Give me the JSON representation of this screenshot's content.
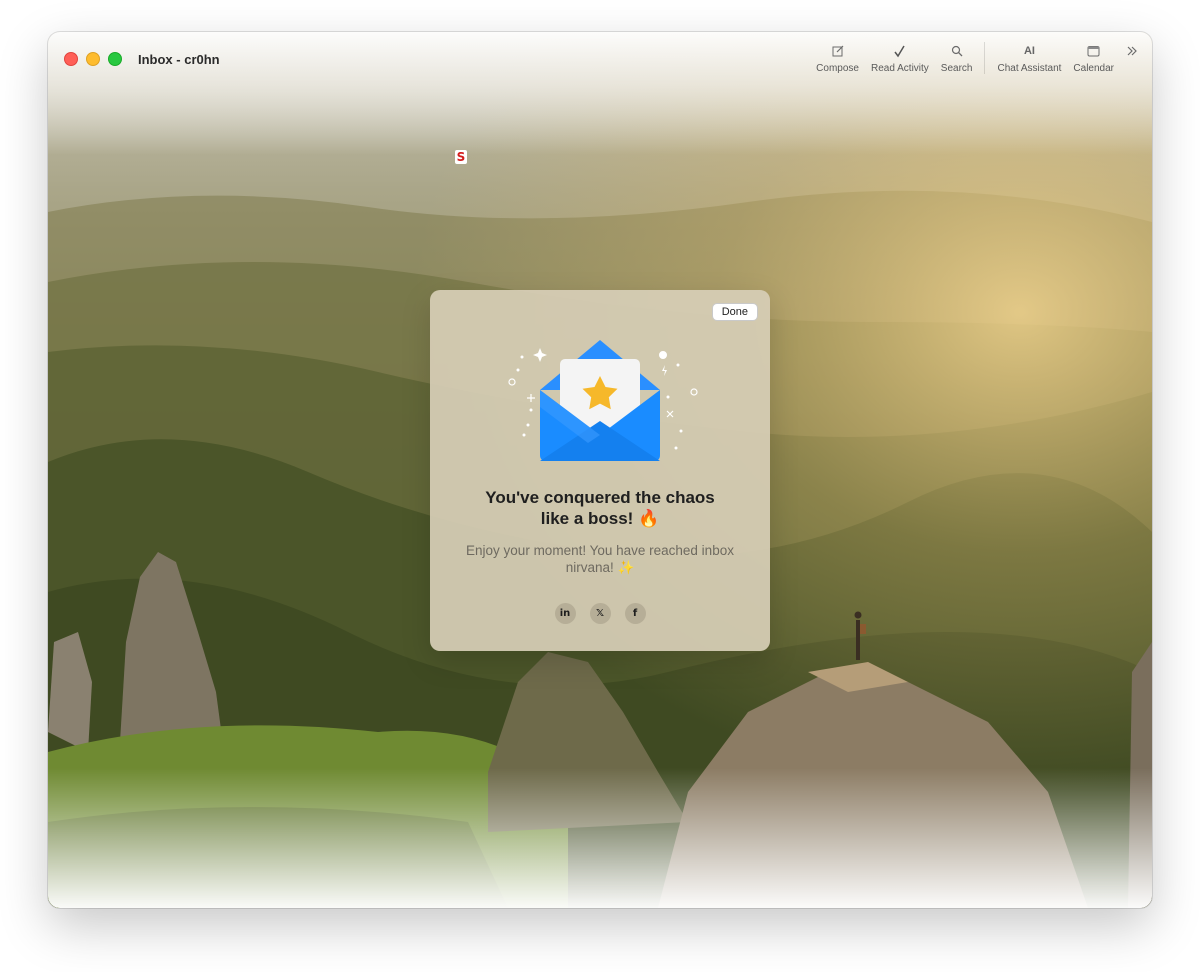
{
  "window": {
    "title": "Inbox - cr0hn"
  },
  "toolbar": {
    "items": [
      {
        "label": "Compose",
        "icon": "compose-icon"
      },
      {
        "label": "Read Activity",
        "icon": "checkmark-icon"
      },
      {
        "label": "Search",
        "icon": "search-icon"
      },
      {
        "label": "Chat Assistant",
        "icon": "ai-icon",
        "glyph": "AI"
      },
      {
        "label": "Calendar",
        "icon": "calendar-icon"
      }
    ],
    "overflow_icon": "double-chevron-right-icon"
  },
  "extension_badge": {
    "text": "S",
    "color": "#d41d1d"
  },
  "dialog": {
    "done_label": "Done",
    "title_line1": "You've conquered the chaos",
    "title_line2": "like a boss! 🔥",
    "subtitle_line1": "Enjoy your moment! You have reached inbox",
    "subtitle_line2": "nirvana! ✨",
    "socials": [
      {
        "label": "in",
        "icon": "linkedin-icon"
      },
      {
        "label": "𝕏",
        "icon": "x-icon"
      },
      {
        "label": "f",
        "icon": "facebook-icon"
      }
    ]
  },
  "colors": {
    "envelope_blue": "#1a8cff",
    "star_yellow": "#f6b82a",
    "close": "#ff5f57",
    "minimize": "#febc2e",
    "maximize": "#28c840"
  }
}
